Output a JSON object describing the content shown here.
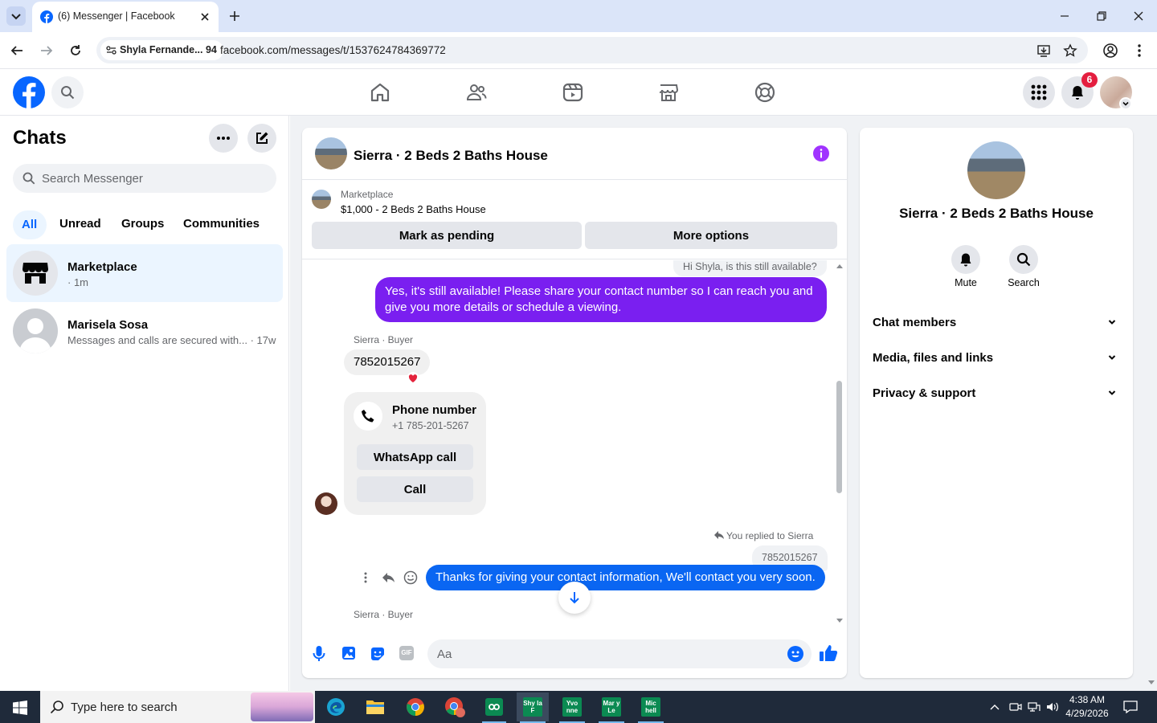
{
  "browser": {
    "tab_title": "(6) Messenger | Facebook",
    "profile_chip": "Shyla Fernande... 94",
    "url": "facebook.com/messages/t/1537624784369772"
  },
  "fb_header": {
    "notification_count": "6"
  },
  "left_panel": {
    "title": "Chats",
    "search_placeholder": "Search Messenger",
    "filters": [
      "All",
      "Unread",
      "Groups",
      "Communities"
    ],
    "chats": [
      {
        "name": "Marketplace",
        "sub": "· 1m"
      },
      {
        "name": "Marisela Sosa",
        "sub": "Messages and calls are secured with... · 17w"
      }
    ]
  },
  "conversation": {
    "title": "Sierra · 2 Beds 2 Baths House",
    "marketplace_label": "Marketplace",
    "listing": "$1,000 - 2 Beds 2 Baths House",
    "mark_pending": "Mark as pending",
    "more_options": "More options",
    "messages": {
      "quoted_top": "Hi Shyla, is this still available?",
      "reply_1": "Yes, it's still available! Please share your contact number so I can reach you and give you more details or schedule a viewing.",
      "sender_1": "Sierra · Buyer",
      "phone_msg": "7852015267",
      "phone_card_title": "Phone number",
      "phone_card_number": "+1 785-201-5267",
      "whatsapp_call": "WhatsApp call",
      "call": "Call",
      "replied_label": "You replied to Sierra",
      "quoted_phone": "7852015267",
      "reply_2": "Thanks for giving your contact information, We'll contact you very soon.",
      "sender_2": "Sierra · Buyer"
    },
    "composer_placeholder": "Aa"
  },
  "right_panel": {
    "title": "Sierra · 2 Beds 2 Baths House",
    "mute": "Mute",
    "search": "Search",
    "sections": [
      "Chat members",
      "Media, files and links",
      "Privacy & support"
    ]
  },
  "taskbar": {
    "search_placeholder": "Type here to search",
    "time": "4:38 AM",
    "date": "4/29/2026",
    "apps": [
      "Shy la F",
      "Yvo nne",
      "Mar y Le",
      "Mic hell"
    ]
  },
  "colors": {
    "fb_blue": "#0866ff",
    "purple_bubble": "#7a1ff0",
    "blue_bubble": "#0a66f2"
  }
}
